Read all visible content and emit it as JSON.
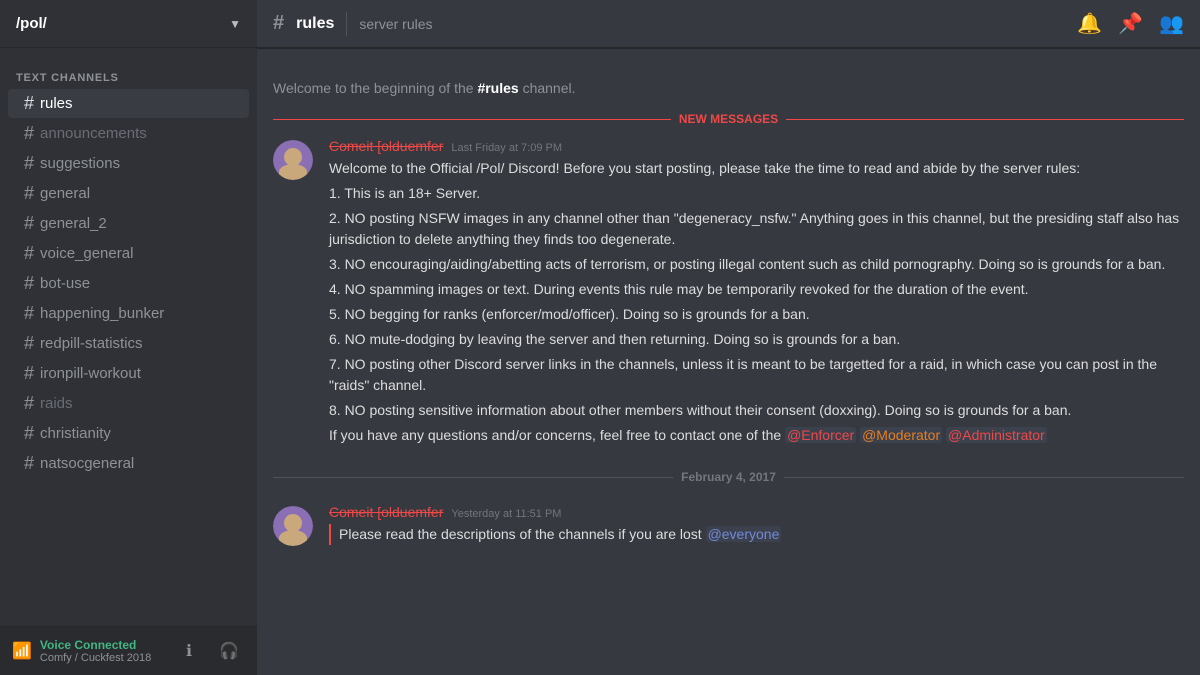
{
  "server": {
    "name": "/pol/",
    "chevron": "▼"
  },
  "sidebar": {
    "section_label": "TEXT CHANNELS",
    "channels": [
      {
        "name": "rules",
        "active": true,
        "muted": false
      },
      {
        "name": "announcements",
        "active": false,
        "muted": true
      },
      {
        "name": "suggestions",
        "active": false,
        "muted": false
      },
      {
        "name": "general",
        "active": false,
        "muted": false
      },
      {
        "name": "general_2",
        "active": false,
        "muted": false
      },
      {
        "name": "voice_general",
        "active": false,
        "muted": false
      },
      {
        "name": "bot-use",
        "active": false,
        "muted": false
      },
      {
        "name": "happening_bunker",
        "active": false,
        "muted": false
      },
      {
        "name": "redpill-statistics",
        "active": false,
        "muted": false
      },
      {
        "name": "ironpill-workout",
        "active": false,
        "muted": false
      },
      {
        "name": "raids",
        "active": false,
        "muted": true
      },
      {
        "name": "christianity",
        "active": false,
        "muted": false
      },
      {
        "name": "natsocgeneral",
        "active": false,
        "muted": false
      }
    ]
  },
  "voice_bar": {
    "label": "Voice Connected",
    "channel": "Comfy / Cuckfest 2018"
  },
  "channel_header": {
    "hash": "#",
    "name": "rules",
    "topic": "server rules"
  },
  "channel_start": {
    "text": "Welcome to the beginning of the ",
    "channel_ref": "#rules",
    "suffix": " channel."
  },
  "new_messages_label": "NEW MESSAGES",
  "messages": [
    {
      "username": "Comeit [olduemfer",
      "timestamp": "Last Friday at 7:09 PM",
      "content": "Welcome to the Official /Pol/ Discord! Before you start posting, please take the time to read and abide by the server rules:",
      "rules": [
        "1. This is an 18+ Server.",
        "2. NO posting NSFW images in any channel other than \"degeneracy_nsfw.\" Anything goes in this channel, but the presiding staff also has jurisdiction to delete anything they finds too degenerate.",
        "3. NO encouraging/aiding/abetting acts of terrorism, or posting illegal content such as child pornography. Doing so is grounds for a ban.",
        "4. NO spamming images or text. During events this rule may be temporarily revoked for the duration of the event.",
        "5. NO begging for ranks (enforcer/mod/officer). Doing so is grounds for a ban.",
        "6. NO mute-dodging by leaving the server and then returning. Doing so is grounds for a ban.",
        "7. NO posting other Discord server links in the channels, unless it is meant to be targetted for a raid, in which case you can post in the \"raids\" channel.",
        "8. NO posting sensitive information about other members without their consent (doxxing). Doing so is grounds for a ban."
      ],
      "contact_prefix": "If you have any questions and/or concerns, feel free to contact one of the ",
      "enforcer": "@Enforcer",
      "moderator": "@Moderator",
      "administrator": "@Administrator"
    }
  ],
  "date_divider": "February 4, 2017",
  "second_message": {
    "username": "Comeit [olduemfer",
    "timestamp": "Yesterday at 11:51 PM",
    "content": "Please read the descriptions of the channels if you are lost ",
    "mention": "@everyone"
  }
}
